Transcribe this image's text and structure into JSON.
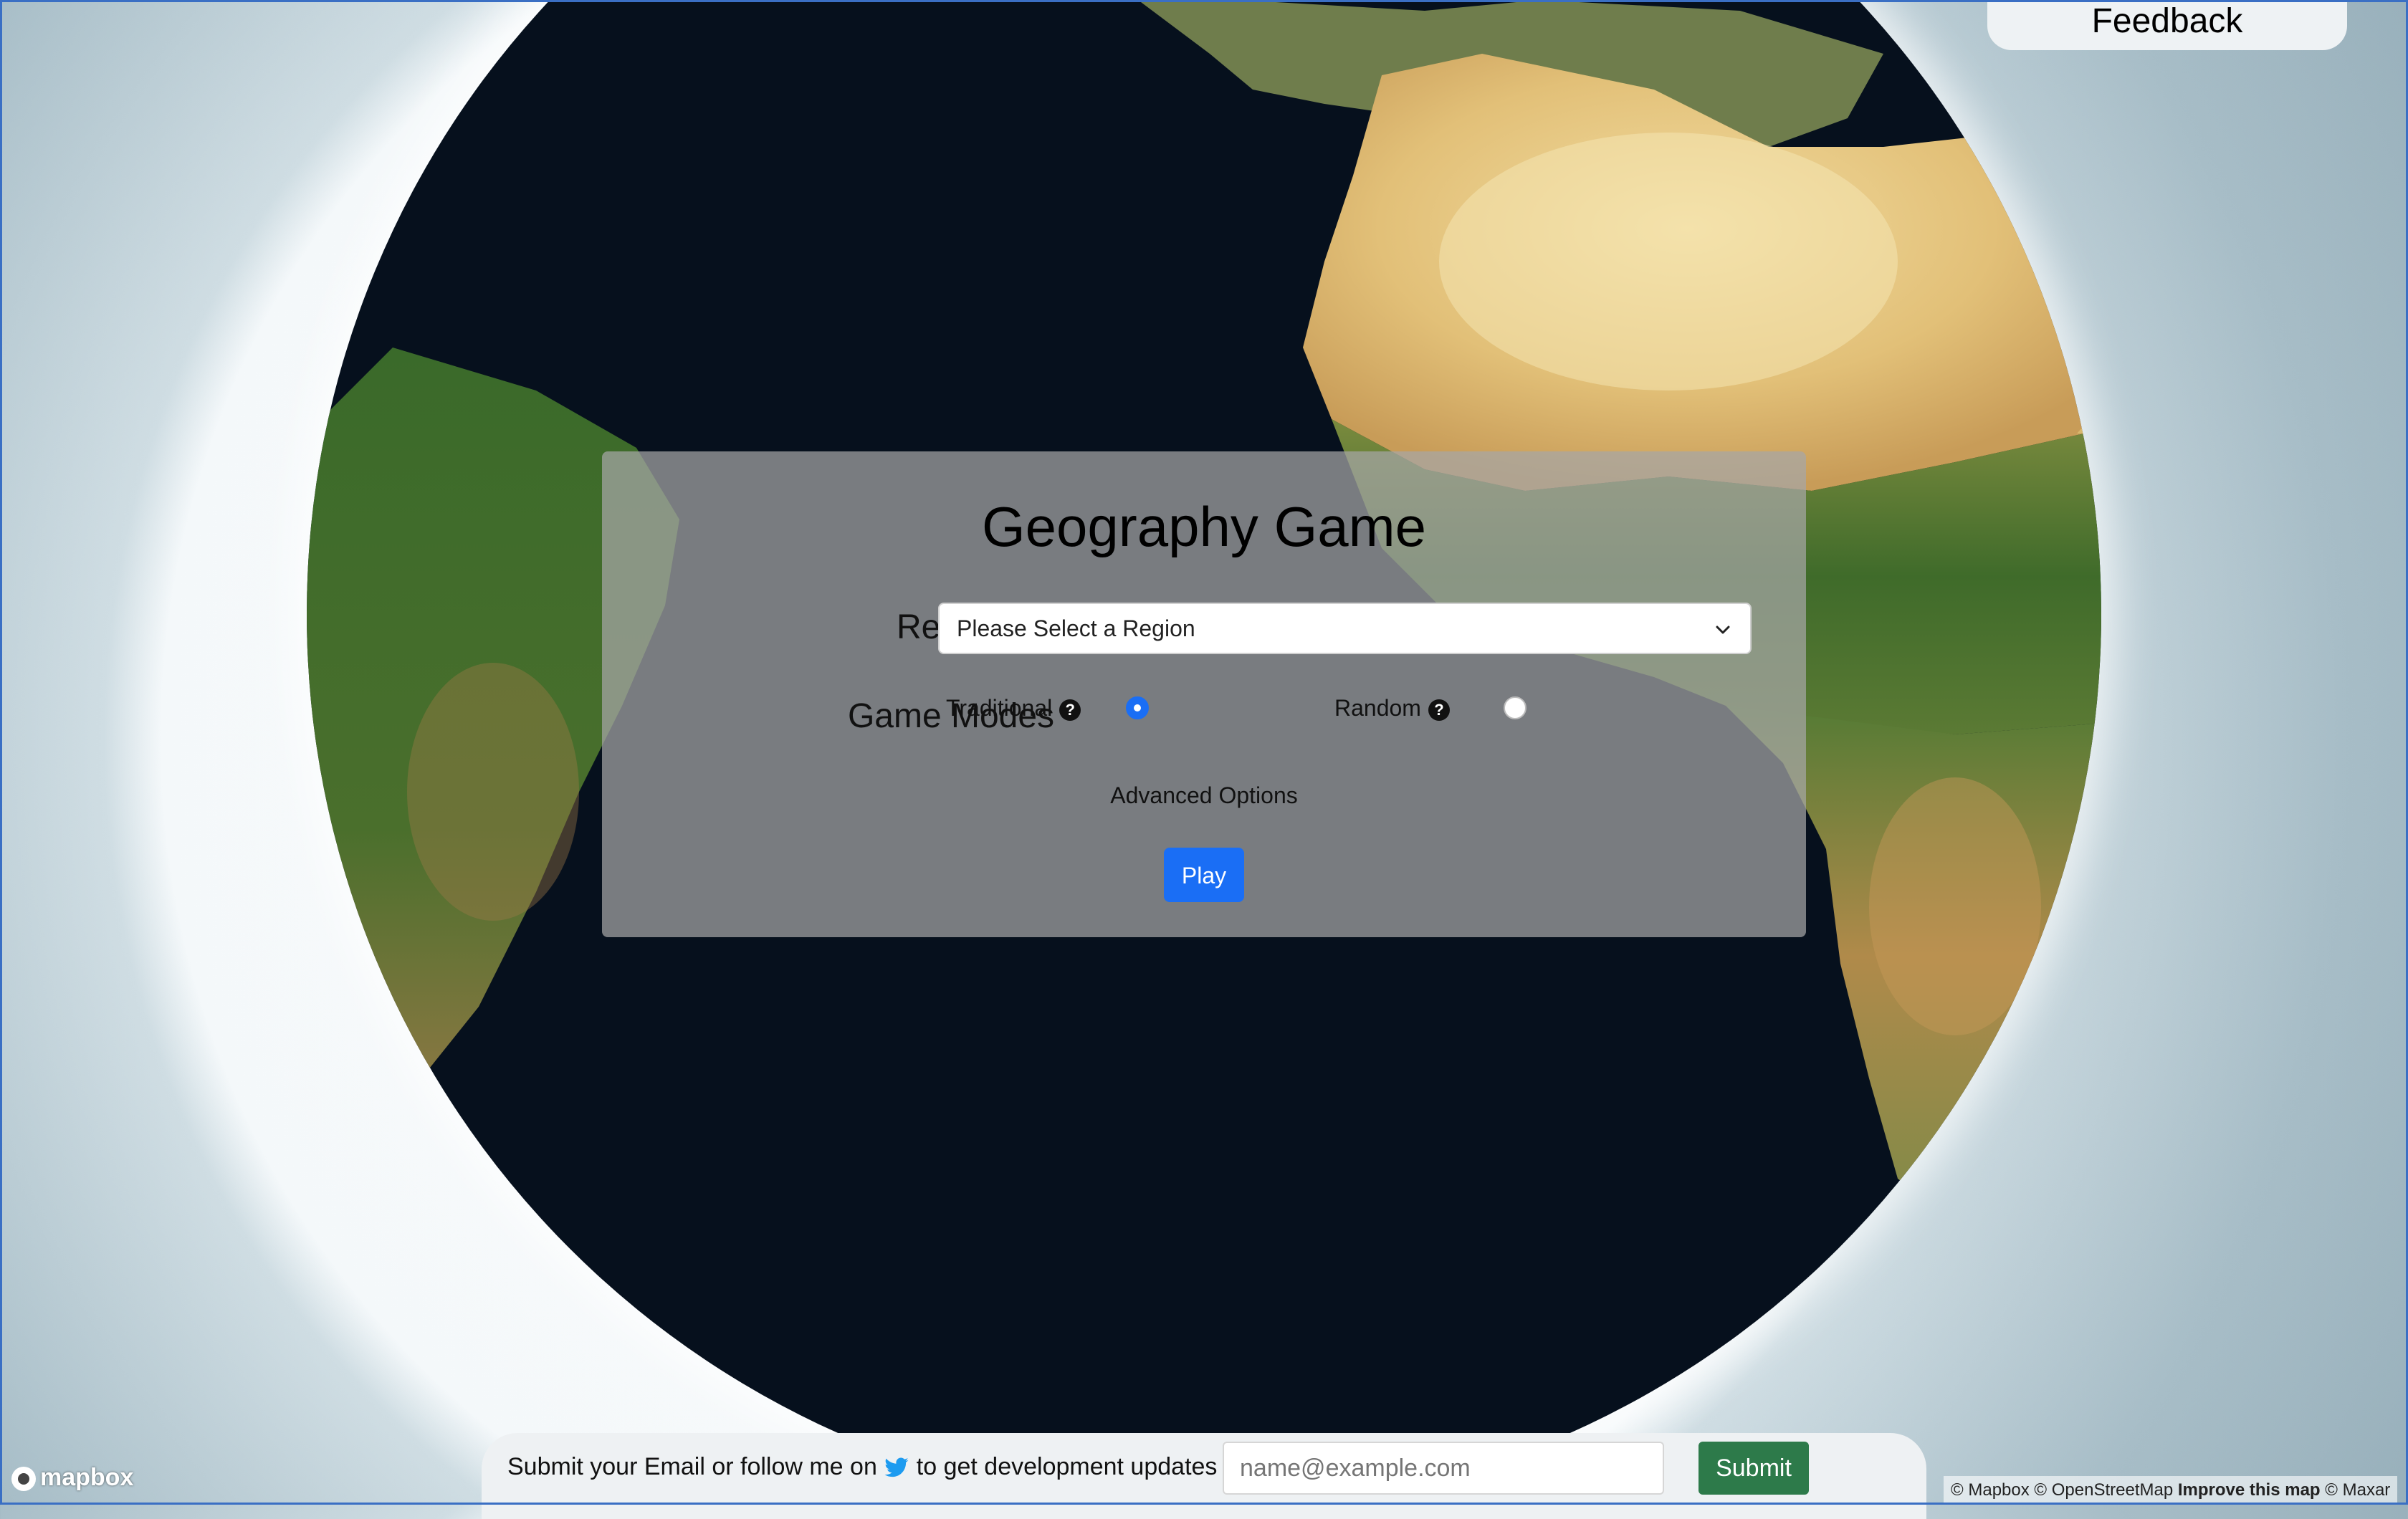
{
  "feedback": {
    "label": "Feedback"
  },
  "panel": {
    "title": "Geography Game",
    "region_label": "Region",
    "region_select": {
      "selected": "Please Select a Region"
    },
    "modes_label": "Game Modes",
    "modes": [
      {
        "label": "Traditional",
        "help": "?",
        "selected": true
      },
      {
        "label": "Random",
        "help": "?",
        "selected": false
      }
    ],
    "advanced_label": "Advanced Options",
    "play_label": "Play"
  },
  "bottom_bar": {
    "text_before": "Submit your Email or follow me on",
    "text_after": "to get development updates",
    "email_placeholder": "name@example.com",
    "submit_label": "Submit"
  },
  "map": {
    "logo_text": "mapbox",
    "attribution": {
      "mapbox": "© Mapbox",
      "osm": "© OpenStreetMap",
      "improve": "Improve this map",
      "maxar": "© Maxar"
    }
  },
  "colors": {
    "accent": "#1a6ef5",
    "submit_green": "#2d7a4a",
    "ocean": "#06101d"
  }
}
